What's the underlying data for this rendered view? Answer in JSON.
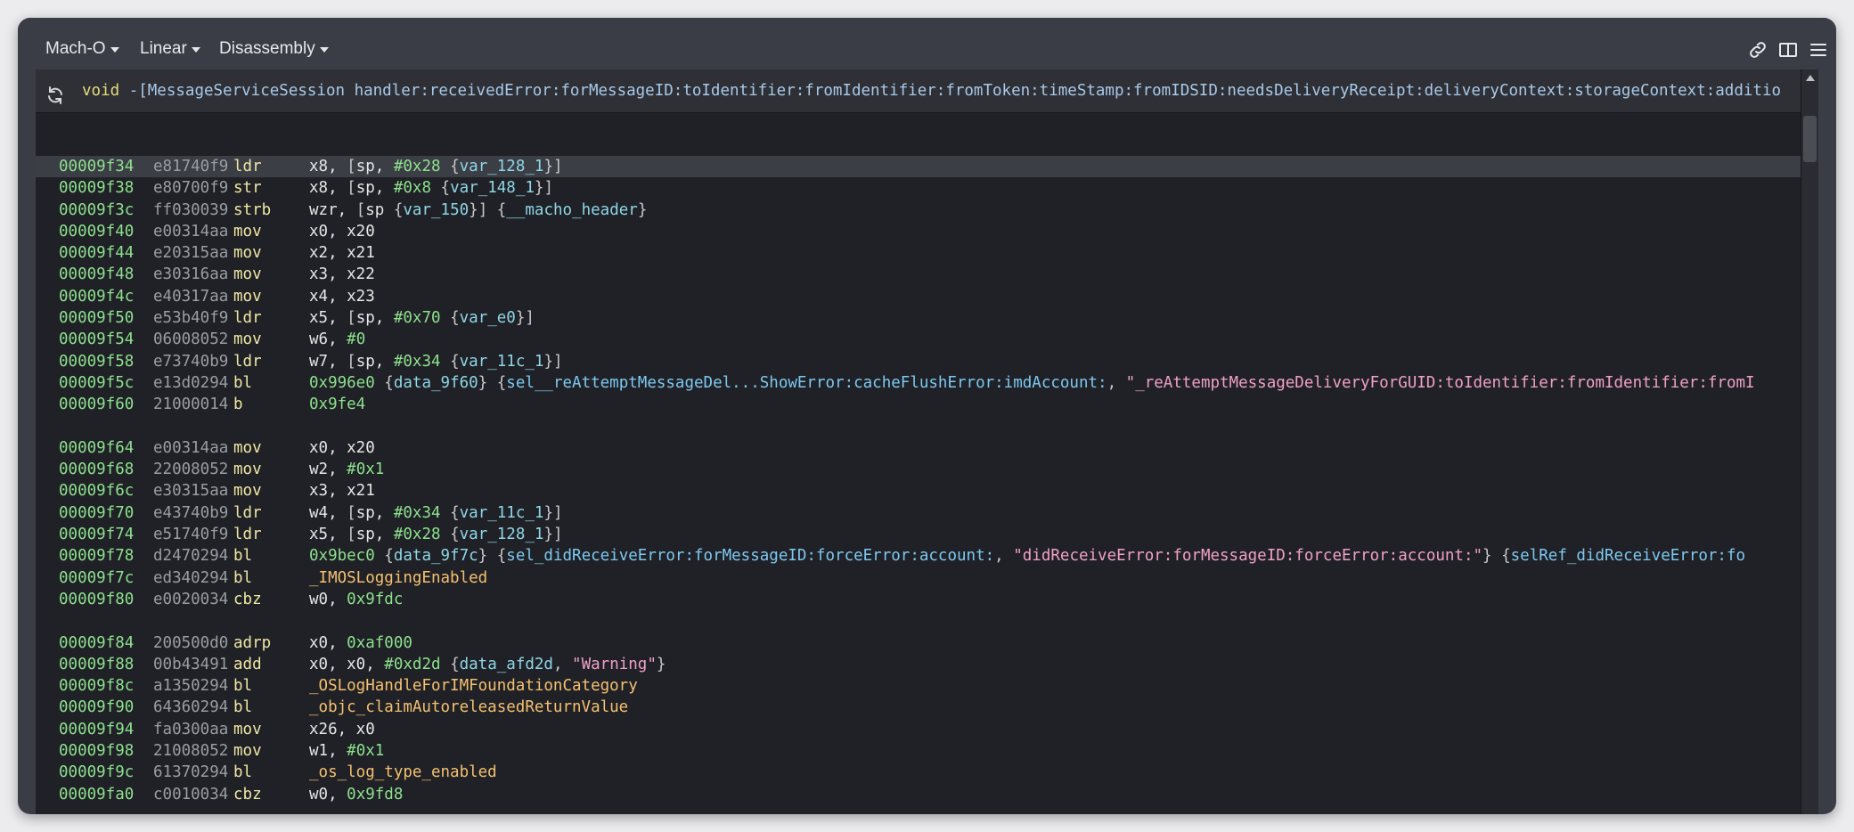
{
  "toolbar": {
    "view_format": "Mach-O",
    "view_mode": "Linear",
    "view_type": "Disassembly"
  },
  "function_header": {
    "keyword": "void",
    "signature": "-[MessageServiceSession handler:receivedError:forMessageID:toIdentifier:fromIdentifier:fromToken:timeStamp:fromIDSID:needsDeliveryReceipt:deliveryContext:storageContext:additio"
  },
  "rows": [
    {
      "addr": "00009f34",
      "bytes": "e81740f9",
      "mnemonic": "ldr",
      "ops": [
        [
          "reg",
          "x8, "
        ],
        [
          "pun",
          "["
        ],
        [
          "reg",
          "sp, "
        ],
        [
          "imm",
          "#0x28 "
        ],
        [
          "pun",
          "{"
        ],
        [
          "var",
          "var_128_1"
        ],
        [
          "pun",
          "}]"
        ]
      ]
    },
    {
      "addr": "00009f38",
      "bytes": "e80700f9",
      "mnemonic": "str",
      "ops": [
        [
          "reg",
          "x8, "
        ],
        [
          "pun",
          "["
        ],
        [
          "reg",
          "sp, "
        ],
        [
          "imm",
          "#0x8 "
        ],
        [
          "pun",
          "{"
        ],
        [
          "var",
          "var_148_1"
        ],
        [
          "pun",
          "}]"
        ]
      ]
    },
    {
      "addr": "00009f3c",
      "bytes": "ff030039",
      "mnemonic": "strb",
      "ops": [
        [
          "reg",
          "wzr, "
        ],
        [
          "pun",
          "["
        ],
        [
          "reg",
          "sp "
        ],
        [
          "pun",
          "{"
        ],
        [
          "var",
          "var_150"
        ],
        [
          "pun",
          "}]  {"
        ],
        [
          "var",
          "__macho_header"
        ],
        [
          "pun",
          "}"
        ]
      ]
    },
    {
      "addr": "00009f40",
      "bytes": "e00314aa",
      "mnemonic": "mov",
      "ops": [
        [
          "reg",
          "x0, x20"
        ]
      ]
    },
    {
      "addr": "00009f44",
      "bytes": "e20315aa",
      "mnemonic": "mov",
      "ops": [
        [
          "reg",
          "x2, x21"
        ]
      ]
    },
    {
      "addr": "00009f48",
      "bytes": "e30316aa",
      "mnemonic": "mov",
      "ops": [
        [
          "reg",
          "x3, x22"
        ]
      ]
    },
    {
      "addr": "00009f4c",
      "bytes": "e40317aa",
      "mnemonic": "mov",
      "ops": [
        [
          "reg",
          "x4, x23"
        ]
      ]
    },
    {
      "addr": "00009f50",
      "bytes": "e53b40f9",
      "mnemonic": "ldr",
      "ops": [
        [
          "reg",
          "x5, "
        ],
        [
          "pun",
          "["
        ],
        [
          "reg",
          "sp, "
        ],
        [
          "imm",
          "#0x70 "
        ],
        [
          "pun",
          "{"
        ],
        [
          "var",
          "var_e0"
        ],
        [
          "pun",
          "}]"
        ]
      ]
    },
    {
      "addr": "00009f54",
      "bytes": "06008052",
      "mnemonic": "mov",
      "ops": [
        [
          "reg",
          "w6, "
        ],
        [
          "imm",
          "#0"
        ]
      ]
    },
    {
      "addr": "00009f58",
      "bytes": "e73740b9",
      "mnemonic": "ldr",
      "ops": [
        [
          "reg",
          "w7, "
        ],
        [
          "pun",
          "["
        ],
        [
          "reg",
          "sp, "
        ],
        [
          "imm",
          "#0x34 "
        ],
        [
          "pun",
          "{"
        ],
        [
          "var",
          "var_11c_1"
        ],
        [
          "pun",
          "}]"
        ]
      ]
    },
    {
      "addr": "00009f5c",
      "bytes": "e13d0294",
      "mnemonic": "bl",
      "ops": [
        [
          "imm",
          "0x996e0  "
        ],
        [
          "pun",
          "{"
        ],
        [
          "var",
          "data_9f60"
        ],
        [
          "pun",
          "}  {"
        ],
        [
          "sel",
          "sel__reAttemptMessageDel...ShowError:cacheFlushError:imdAccount:"
        ],
        [
          "pun",
          ", "
        ],
        [
          "str",
          "\"_reAttemptMessageDeliveryForGUID:toIdentifier:fromIdentifier:fromI"
        ]
      ]
    },
    {
      "addr": "00009f60",
      "bytes": "21000014",
      "mnemonic": "b",
      "ops": [
        [
          "imm",
          "0x9fe4"
        ]
      ]
    },
    {
      "blank": true
    },
    {
      "addr": "00009f64",
      "bytes": "e00314aa",
      "mnemonic": "mov",
      "ops": [
        [
          "reg",
          "x0, x20"
        ]
      ]
    },
    {
      "addr": "00009f68",
      "bytes": "22008052",
      "mnemonic": "mov",
      "ops": [
        [
          "reg",
          "w2, "
        ],
        [
          "imm",
          "#0x1"
        ]
      ]
    },
    {
      "addr": "00009f6c",
      "bytes": "e30315aa",
      "mnemonic": "mov",
      "ops": [
        [
          "reg",
          "x3, x21"
        ]
      ]
    },
    {
      "addr": "00009f70",
      "bytes": "e43740b9",
      "mnemonic": "ldr",
      "ops": [
        [
          "reg",
          "w4, "
        ],
        [
          "pun",
          "["
        ],
        [
          "reg",
          "sp, "
        ],
        [
          "imm",
          "#0x34 "
        ],
        [
          "pun",
          "{"
        ],
        [
          "var",
          "var_11c_1"
        ],
        [
          "pun",
          "}]"
        ]
      ]
    },
    {
      "addr": "00009f74",
      "bytes": "e51740f9",
      "mnemonic": "ldr",
      "ops": [
        [
          "reg",
          "x5, "
        ],
        [
          "pun",
          "["
        ],
        [
          "reg",
          "sp, "
        ],
        [
          "imm",
          "#0x28 "
        ],
        [
          "pun",
          "{"
        ],
        [
          "var",
          "var_128_1"
        ],
        [
          "pun",
          "}]"
        ]
      ]
    },
    {
      "addr": "00009f78",
      "bytes": "d2470294",
      "mnemonic": "bl",
      "ops": [
        [
          "imm",
          "0x9bec0  "
        ],
        [
          "pun",
          "{"
        ],
        [
          "var",
          "data_9f7c"
        ],
        [
          "pun",
          "}  {"
        ],
        [
          "sel",
          "sel_didReceiveError:forMessageID:forceError:account:"
        ],
        [
          "pun",
          ", "
        ],
        [
          "str",
          "\"didReceiveError:forMessageID:forceError:account:\""
        ],
        [
          "pun",
          "}  {"
        ],
        [
          "sel",
          "selRef_didReceiveError:fo"
        ]
      ]
    },
    {
      "addr": "00009f7c",
      "bytes": "ed340294",
      "mnemonic": "bl",
      "ops": [
        [
          "sym",
          "_IMOSLoggingEnabled"
        ]
      ]
    },
    {
      "addr": "00009f80",
      "bytes": "e0020034",
      "mnemonic": "cbz",
      "ops": [
        [
          "reg",
          "w0, "
        ],
        [
          "imm",
          "0x9fdc"
        ]
      ]
    },
    {
      "blank": true
    },
    {
      "addr": "00009f84",
      "bytes": "200500d0",
      "mnemonic": "adrp",
      "ops": [
        [
          "reg",
          "x0, "
        ],
        [
          "imm",
          "0xaf000"
        ]
      ]
    },
    {
      "addr": "00009f88",
      "bytes": "00b43491",
      "mnemonic": "add",
      "ops": [
        [
          "reg",
          "x0, x0, "
        ],
        [
          "imm",
          "#0xd2d  "
        ],
        [
          "pun",
          "{"
        ],
        [
          "var",
          "data_afd2d"
        ],
        [
          "pun",
          ", "
        ],
        [
          "str",
          "\"Warning\""
        ],
        [
          "pun",
          "}"
        ]
      ]
    },
    {
      "addr": "00009f8c",
      "bytes": "a1350294",
      "mnemonic": "bl",
      "ops": [
        [
          "sym",
          "_OSLogHandleForIMFoundationCategory"
        ]
      ]
    },
    {
      "addr": "00009f90",
      "bytes": "64360294",
      "mnemonic": "bl",
      "ops": [
        [
          "sym",
          "_objc_claimAutoreleasedReturnValue"
        ]
      ]
    },
    {
      "addr": "00009f94",
      "bytes": "fa0300aa",
      "mnemonic": "mov",
      "ops": [
        [
          "reg",
          "x26, x0"
        ]
      ]
    },
    {
      "addr": "00009f98",
      "bytes": "21008052",
      "mnemonic": "mov",
      "ops": [
        [
          "reg",
          "w1, "
        ],
        [
          "imm",
          "#0x1"
        ]
      ]
    },
    {
      "addr": "00009f9c",
      "bytes": "61370294",
      "mnemonic": "bl",
      "ops": [
        [
          "sym",
          "_os_log_type_enabled"
        ]
      ]
    },
    {
      "addr": "00009fa0",
      "bytes": "c0010034",
      "mnemonic": "cbz",
      "ops": [
        [
          "reg",
          "w0, "
        ],
        [
          "imm",
          "0x9fd8"
        ]
      ]
    }
  ]
}
